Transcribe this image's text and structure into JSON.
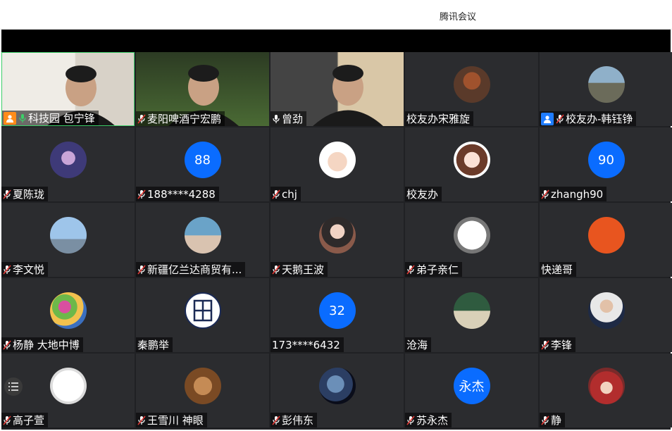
{
  "app": {
    "title": "腾讯会议"
  },
  "colors": {
    "grid_bg": "#202124",
    "tile_bg": "#2b2c2f",
    "accent_blue": "#0a6cff",
    "active_border": "#3ccf68",
    "mic_muted_red": "#e53935",
    "mic_on_green": "#3ccf68"
  },
  "participants": [
    {
      "name": "科技园 包宁锋",
      "kind": "video",
      "mic": "on",
      "host": "orange-host-icon",
      "active": true
    },
    {
      "name": "麦阳啤酒宁宏鹏",
      "kind": "video",
      "mic": "muted"
    },
    {
      "name": "曾劲",
      "kind": "video",
      "mic": "on-white"
    },
    {
      "name": "校友办宋雅旋",
      "kind": "photo",
      "mic": "none",
      "avatar": "teddy-bear-avatar"
    },
    {
      "name": "校友办-韩钰铮",
      "kind": "photo",
      "mic": "muted",
      "host": "blue-host-icon",
      "avatar": "group-photo-avatar"
    },
    {
      "name": "夏陈珑",
      "kind": "photo",
      "mic": "muted",
      "avatar": "anime-avatar"
    },
    {
      "name": "188****4288",
      "kind": "text",
      "mic": "muted",
      "avatar_text": "88"
    },
    {
      "name": "chj",
      "kind": "photo",
      "mic": "muted",
      "avatar": "cartoon-man-avatar"
    },
    {
      "name": "校友办",
      "kind": "photo",
      "mic": "none",
      "avatar": "cartoon-girl-avatar"
    },
    {
      "name": "zhangh90",
      "kind": "text",
      "mic": "muted",
      "avatar_text": "90"
    },
    {
      "name": "李文悦",
      "kind": "photo",
      "mic": "muted",
      "avatar": "skyline-avatar"
    },
    {
      "name": "新疆亿兰达商贸有...",
      "kind": "photo",
      "mic": "muted",
      "avatar": "woman-sea-avatar"
    },
    {
      "name": "天鹅王波",
      "kind": "photo",
      "mic": "muted",
      "avatar": "woman-portrait-avatar"
    },
    {
      "name": "弟子亲仁",
      "kind": "photo",
      "mic": "muted",
      "avatar": "calligraphy-avatar"
    },
    {
      "name": "快递哥",
      "kind": "photo",
      "mic": "none",
      "avatar": "courier-logo-avatar"
    },
    {
      "name": "杨静 大地中博",
      "kind": "photo",
      "mic": "muted",
      "avatar": "flowers-avatar"
    },
    {
      "name": "秦鹏举",
      "kind": "seal",
      "mic": "none",
      "avatar": "seal-avatar"
    },
    {
      "name": "173****6432",
      "kind": "text",
      "mic": "none",
      "avatar_text": "32"
    },
    {
      "name": "沧海",
      "kind": "photo",
      "mic": "none",
      "avatar": "landscape-avatar"
    },
    {
      "name": "李锋",
      "kind": "photo",
      "mic": "muted",
      "avatar": "man-suit-avatar"
    },
    {
      "name": "高子萱",
      "kind": "photo",
      "mic": "muted",
      "avatar": "dancer-avatar"
    },
    {
      "name": "王雪川 神眼",
      "kind": "photo",
      "mic": "muted",
      "avatar": "hands-avatar"
    },
    {
      "name": "彭伟东",
      "kind": "photo",
      "mic": "muted",
      "avatar": "planet-avatar"
    },
    {
      "name": "苏永杰",
      "kind": "text",
      "mic": "muted",
      "avatar_text": "永杰"
    },
    {
      "name": "静",
      "kind": "photo",
      "mic": "muted",
      "avatar": "girl-hat-avatar"
    }
  ]
}
